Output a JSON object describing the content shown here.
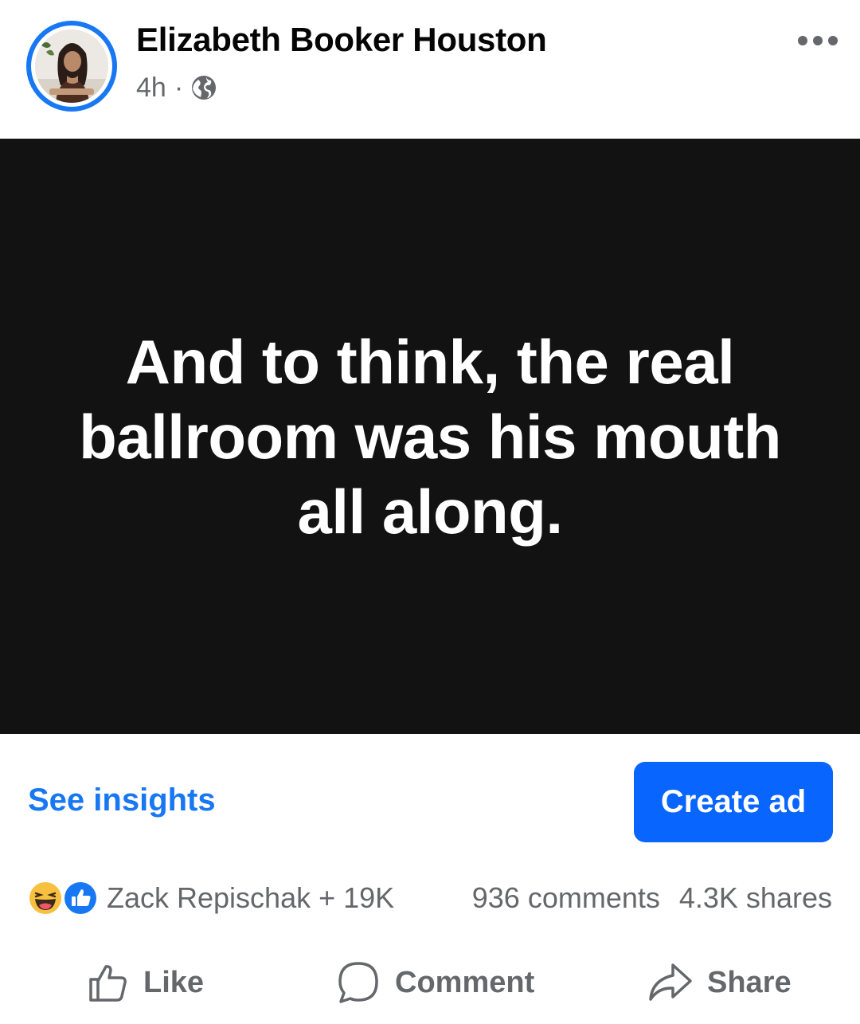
{
  "post": {
    "author": "Elizabeth Booker Houston",
    "time": "4h",
    "separator": "·",
    "audience_icon": "globe-icon",
    "more_icon": "ellipsis-icon"
  },
  "image_text": "And to think, the real ballroom was his mouth all along.",
  "insights": {
    "see_insights": "See insights",
    "create_ad": "Create ad"
  },
  "reactions": {
    "icons": [
      "haha-reaction-icon",
      "like-reaction-icon"
    ],
    "summary": "Zack Repischak + 19K"
  },
  "stats": {
    "comments": "936 comments",
    "shares": "4.3K shares"
  },
  "actions": {
    "like": "Like",
    "comment": "Comment",
    "share": "Share"
  },
  "colors": {
    "accent": "#1877f2",
    "button": "#0866ff",
    "secondary_text": "#65676b",
    "image_background": "#121212"
  }
}
